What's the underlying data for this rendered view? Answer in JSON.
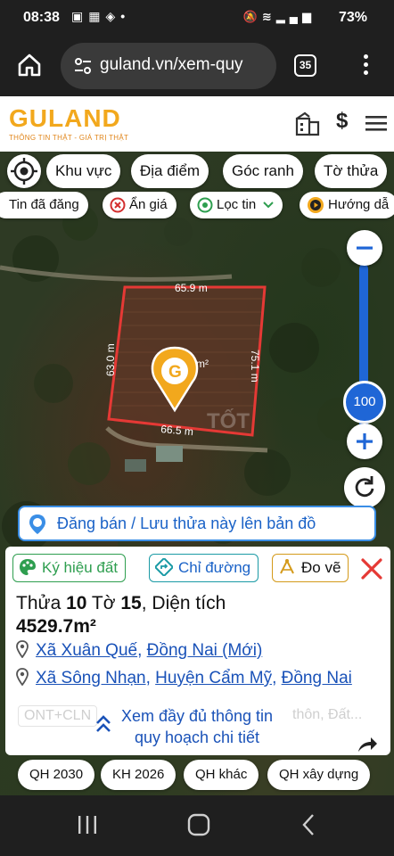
{
  "status_bar": {
    "time": "08:38",
    "battery": "73%",
    "left_icons": [
      "photo-icon",
      "image-icon",
      "shield-icon",
      "dot-icon"
    ],
    "right_icons": [
      "mute-icon",
      "wifi-icon",
      "signal-icon",
      "signal-icon"
    ]
  },
  "browser": {
    "url": "guland.vn/xem-quy",
    "tab_count": "35"
  },
  "site": {
    "brand": "GULAND",
    "tagline": "THÔNG TIN THẬT - GIÁ TRỊ THẬT",
    "header_icons": [
      "building-icon",
      "dollar-icon",
      "hamburger-icon"
    ],
    "brand_color": "#f2a81d"
  },
  "filters": {
    "row1": [
      "Khu vực",
      "Địa điểm",
      "Góc ranh",
      "Tờ thửa"
    ],
    "row2": [
      {
        "label": "Tin đã đăng",
        "icon": "pin-icon"
      },
      {
        "label": "Ẩn giá",
        "icon": "x-circle-icon"
      },
      {
        "label": "Lọc tin",
        "icon": "location-icon"
      },
      {
        "label": "Hướng dẫ",
        "icon": "play-circle-icon"
      }
    ]
  },
  "map": {
    "edge_labels": {
      "top": "65.9 m",
      "left": "63.0 m",
      "right": "75.1 m",
      "bottom": "66.5 m"
    },
    "area_fragment": "m²",
    "watermark": "TỐT",
    "parcel_color": "#e53935",
    "zoom_level": "100"
  },
  "post_banner": {
    "label": "Đăng bán / Lưu thửa này lên bản đồ"
  },
  "panel": {
    "tools": [
      {
        "label": "Ký hiệu đất",
        "color": "#2e9e4f"
      },
      {
        "label": "Chỉ đường",
        "color": "#1a9aa5"
      },
      {
        "label": "Đo vẽ",
        "color": "#d49a1a"
      }
    ],
    "parcel": {
      "prefix": "Thửa",
      "thua_no": "10",
      "to_word": "Tờ",
      "to_no": "15",
      "area_label": ", Diện tích",
      "area": "4529.7m²"
    },
    "address_new": {
      "commune": "Xã Xuân Quế",
      "province": "Đồng Nai (Mới)"
    },
    "address_old": {
      "commune": "Xã Sông Nhạn",
      "district": "Huyện Cẩm Mỹ",
      "province": "Đồng Nai"
    },
    "zone_code": "ONT+CLN",
    "zone_faded": "thôn, Đất...",
    "detail_link_line1": "Xem đầy đủ thông tin",
    "detail_link_line2": "quy hoạch chi tiết"
  },
  "bottom_chips": [
    "QH 2030",
    "KH 2026",
    "QH khác",
    "QH xây dựng"
  ],
  "nav": [
    "recents-icon",
    "home-icon",
    "back-icon"
  ]
}
